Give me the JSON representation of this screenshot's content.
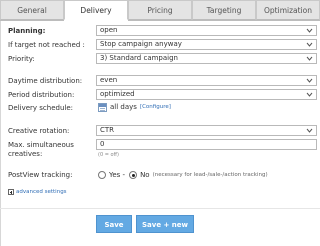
{
  "tabs": [
    {
      "label": "General"
    },
    {
      "label": "Delivery"
    },
    {
      "label": "Pricing"
    },
    {
      "label": "Targeting"
    },
    {
      "label": "Optimization"
    }
  ],
  "active_tab": "Delivery",
  "form": {
    "planning": {
      "label": "Planning:",
      "value": "open"
    },
    "if_target": {
      "label": "If target not reached :",
      "value": "Stop campaign anyway"
    },
    "priority": {
      "label": "Priority:",
      "value": "3) Standard campaign"
    },
    "daytime": {
      "label": "Daytime distribution:",
      "value": "even"
    },
    "period": {
      "label": "Period distribution:",
      "value": "optimized"
    },
    "schedule": {
      "label": "Delivery schedule:",
      "value": "all days",
      "link": "[Configure]"
    },
    "rotation": {
      "label": "Creative rotation:",
      "value": "CTR"
    },
    "max_creatives": {
      "label_line1": "Max. simultaneous",
      "label_line2": "creatives:",
      "value": "0",
      "hint": "(0 = off)"
    },
    "postview": {
      "label": "PostView tracking:",
      "yes_label": "Yes -",
      "no_label": "No",
      "selected": "No",
      "note": "(necessary for lead-/sale-/action tracking)"
    },
    "advanced": {
      "label": "advanced settings"
    }
  },
  "buttons": {
    "save": "Save",
    "save_new": "Save + new"
  },
  "colors": {
    "button": "#63a9e3",
    "link": "#2f6db5",
    "active_tab": "#ffffff",
    "inactive_tab": "#e4e4e4"
  }
}
